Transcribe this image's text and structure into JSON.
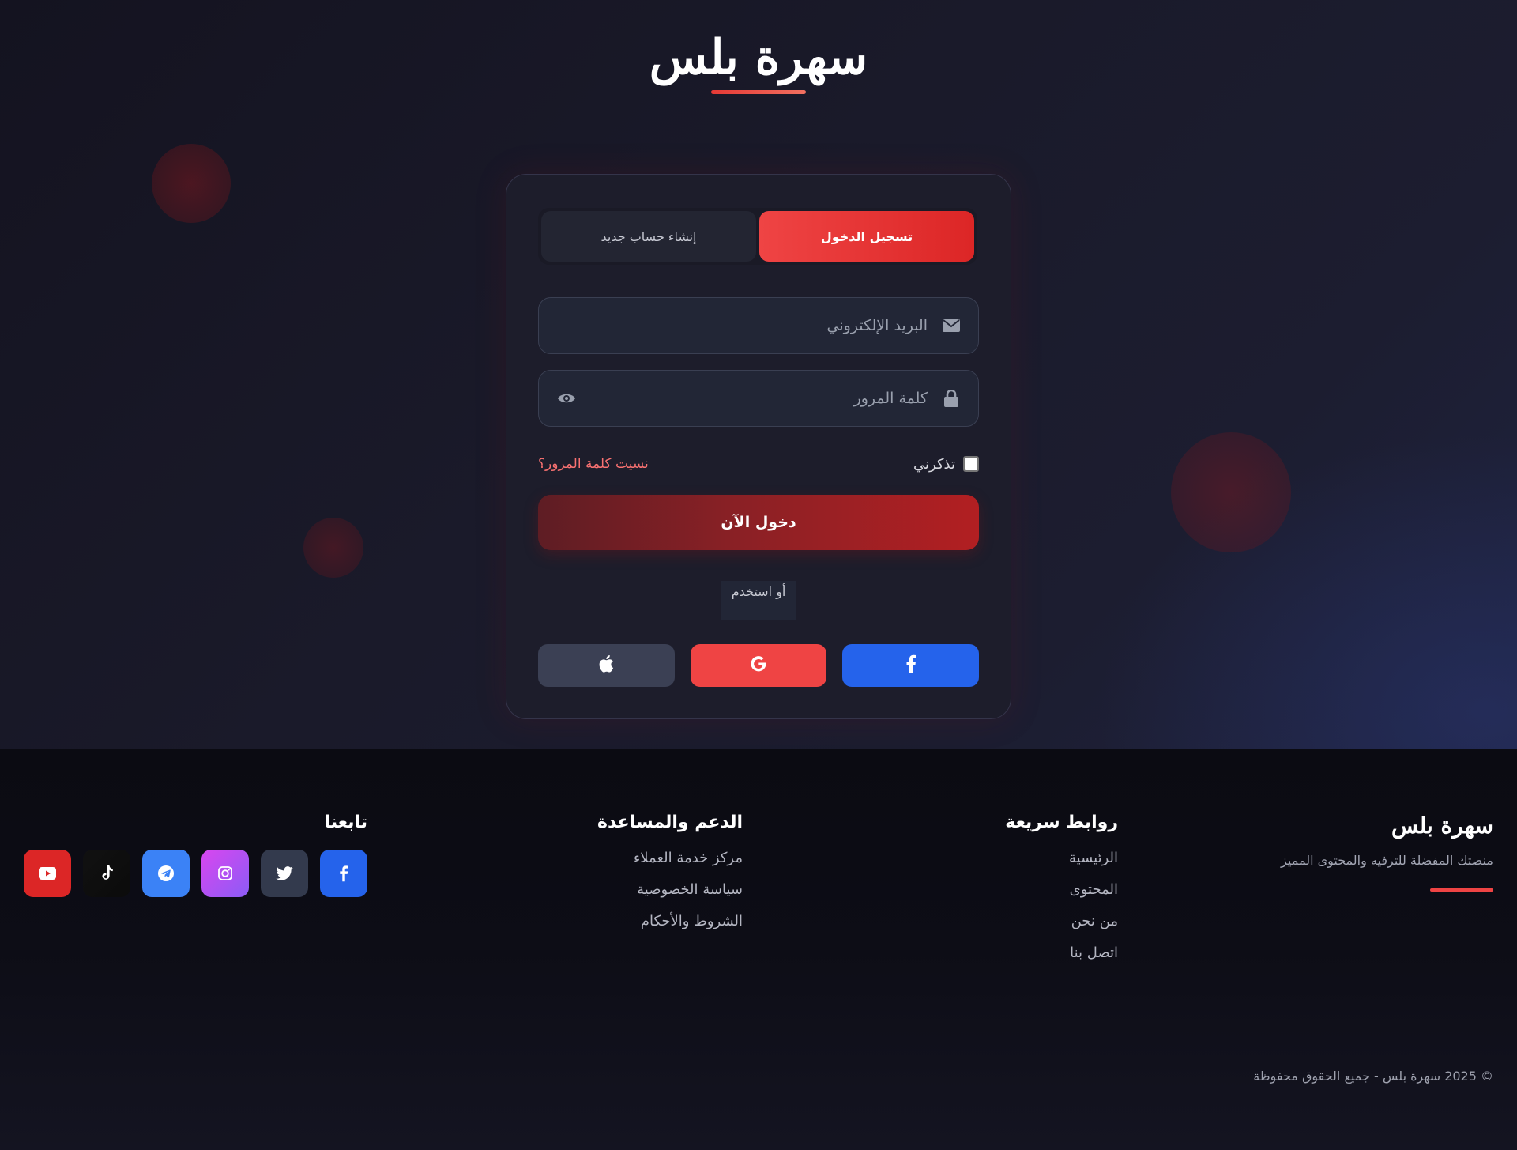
{
  "header": {
    "title": "سهرة بلس"
  },
  "auth": {
    "tabs": {
      "login": "تسجيل الدخول",
      "register": "إنشاء حساب جديد"
    },
    "email_placeholder": "البريد الإلكتروني",
    "password_placeholder": "كلمة المرور",
    "remember_label": "تذكرني",
    "forgot_label": "نسيت كلمة المرور؟",
    "submit_label": "دخول الآن",
    "divider_text": "أو استخدم",
    "social": [
      "facebook",
      "google",
      "apple"
    ]
  },
  "footer": {
    "brand": {
      "title": "سهرة بلس",
      "description": "منصتك المفضلة للترفيه والمحتوى المميز"
    },
    "quick_links": {
      "heading": "روابط سريعة",
      "items": [
        "الرئيسية",
        "المحتوى",
        "من نحن",
        "اتصل بنا"
      ]
    },
    "support": {
      "heading": "الدعم والمساعدة",
      "items": [
        "مركز خدمة العملاء",
        "سياسة الخصوصية",
        "الشروط والأحكام"
      ]
    },
    "follow": {
      "heading": "تابعنا",
      "icons": [
        "facebook-icon",
        "twitter-icon",
        "instagram-icon",
        "telegram-icon",
        "tiktok-icon",
        "youtube-icon"
      ]
    },
    "copyright": "© 2025 سهرة بلس - جميع الحقوق محفوظة"
  },
  "colors": {
    "accent": "#ef4444",
    "facebook": "#2563eb",
    "apple": "#3b4054",
    "submit_start": "#5e1d24",
    "submit_end": "#b21f22"
  }
}
